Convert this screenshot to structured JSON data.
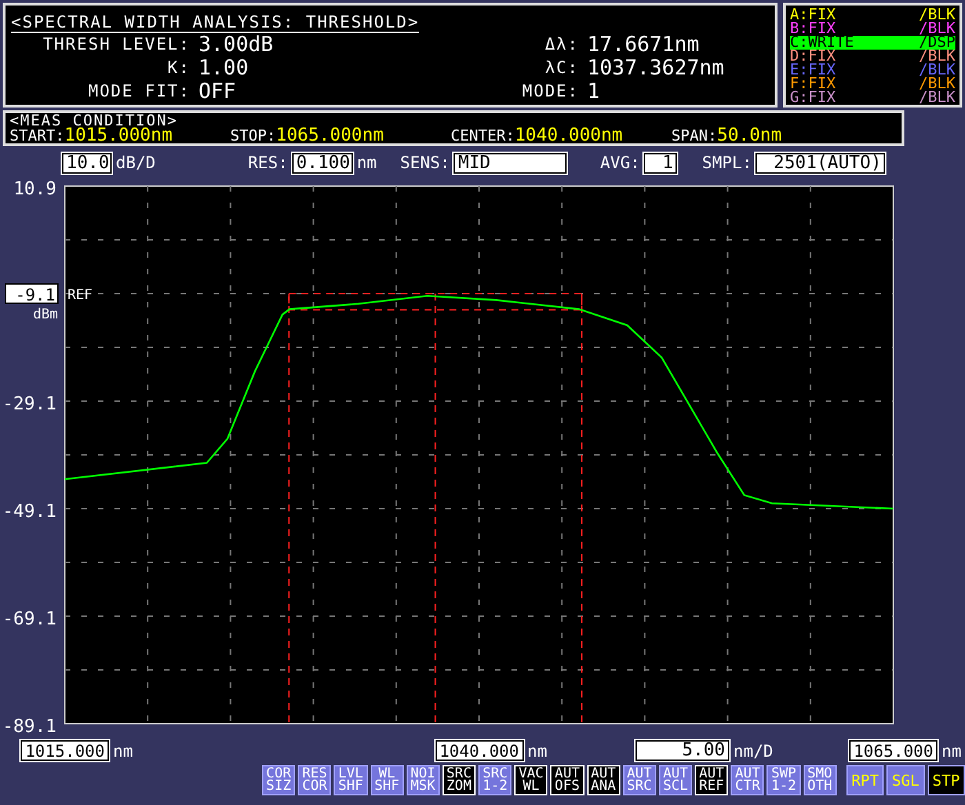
{
  "analysis": {
    "title": "<SPECTRAL WIDTH ANALYSIS: THRESHOLD>",
    "params": [
      {
        "label": "THRESH LEVEL:",
        "value": "3.00dB"
      },
      {
        "label": "K:",
        "value": "1.00"
      },
      {
        "label": "MODE FIT:",
        "value": "OFF"
      }
    ],
    "results": [
      {
        "label": "Δλ:",
        "value": "17.6671nm"
      },
      {
        "label": "λC:",
        "value": "1037.3627nm"
      },
      {
        "label": "MODE:",
        "value": "1"
      }
    ]
  },
  "traces": [
    {
      "name": "A:FIX",
      "display": "/BLK",
      "color": "#ffff00",
      "selected": false
    },
    {
      "name": "B:FIX",
      "display": "/BLK",
      "color": "#ff40ff",
      "selected": false
    },
    {
      "name": "C:WRITE",
      "display": "/DSP",
      "color": "#00ff00",
      "selected": true
    },
    {
      "name": "D:FIX",
      "display": "/BLK",
      "color": "#ff9080",
      "selected": false
    },
    {
      "name": "E:FIX",
      "display": "/BLK",
      "color": "#6868ff",
      "selected": false
    },
    {
      "name": "F:FIX",
      "display": "/BLK",
      "color": "#ff9a00",
      "selected": false
    },
    {
      "name": "G:FIX",
      "display": "/BLK",
      "color": "#c890c8",
      "selected": false
    }
  ],
  "meas_condition": {
    "title": "<MEAS CONDITION>",
    "items": [
      {
        "label": "START:",
        "value": "1015.000nm"
      },
      {
        "label": "STOP:",
        "value": "1065.000nm"
      },
      {
        "label": "CENTER:",
        "value": "1040.000nm"
      },
      {
        "label": "SPAN:",
        "value": "50.0nm"
      }
    ]
  },
  "settings": {
    "scale": {
      "value": "10.0",
      "unit": "dB/D"
    },
    "res": {
      "label": "RES:",
      "value": "0.100",
      "unit": "nm"
    },
    "sens": {
      "label": "SENS:",
      "value": "MID"
    },
    "avg": {
      "label": "AVG:",
      "value": "1"
    },
    "smpl": {
      "label": "SMPL:",
      "value": "2501(AUTO)"
    }
  },
  "ref_level": {
    "value": "-9.1",
    "unit": "dBm",
    "label": "REF"
  },
  "chart_data": {
    "type": "line",
    "xlim": [
      1015,
      1065
    ],
    "ylim": [
      -89.1,
      10.9
    ],
    "yticks": [
      {
        "value": 10.9,
        "label": "10.9"
      },
      {
        "value": -29.1,
        "label": "-29.1"
      },
      {
        "value": -49.1,
        "label": "-49.1"
      },
      {
        "value": -69.1,
        "label": "-69.1"
      },
      {
        "value": -89.1,
        "label": "-89.1"
      }
    ],
    "x": [
      1015,
      1023.57,
      1024.82,
      1026.48,
      1028.14,
      1028.56,
      1032.72,
      1036.88,
      1041.04,
      1046.03,
      1048.94,
      1051.02,
      1054.35,
      1056.01,
      1057.68,
      1065
    ],
    "grid": true,
    "ref_lines": [
      {
        "axis": "x",
        "value": 1028.53
      },
      {
        "axis": "x",
        "value": 1037.36
      },
      {
        "axis": "x",
        "value": 1046.2
      }
    ],
    "xticks": [
      {
        "value": 1015,
        "label": "1015.000"
      },
      {
        "value": 1040,
        "label": "1040.000"
      },
      {
        "value": 1065,
        "label": "1065.000"
      }
    ],
    "series": [
      {
        "color": "#00ff00",
        "values": [
          -43.6,
          -40.6,
          -36.1,
          -23.5,
          -13,
          -12,
          -11,
          -9.5,
          -10.3,
          -12,
          -15,
          -21,
          -38.6,
          -46.6,
          -48.1,
          -49.1
        ]
      }
    ]
  },
  "x_axis": {
    "tick_units": [
      "nm",
      "nm",
      "nm"
    ],
    "span": {
      "value": "5.00",
      "unit": "nm/D"
    }
  },
  "soft_keys": [
    {
      "label": "COR SIZ",
      "on": false
    },
    {
      "label": "RES COR",
      "on": false
    },
    {
      "label": "LVL SHF",
      "on": false
    },
    {
      "label": "WL SHF",
      "on": false
    },
    {
      "label": "NOI MSK",
      "on": false
    },
    {
      "label": "SRC ZOM",
      "on": true
    },
    {
      "label": "SRC 1-2",
      "on": false
    },
    {
      "label": "VAC WL",
      "on": true
    },
    {
      "label": "AUT OFS",
      "on": true
    },
    {
      "label": "AUT ANA",
      "on": true
    },
    {
      "label": "AUT SRC",
      "on": false
    },
    {
      "label": "AUT SCL",
      "on": false
    },
    {
      "label": "AUT REF",
      "on": true
    },
    {
      "label": "AUT CTR",
      "on": false
    },
    {
      "label": "SWP 1-2",
      "on": false
    },
    {
      "label": "SMO OTH",
      "on": false
    }
  ],
  "sweep_keys": [
    {
      "label": "RPT",
      "selected": false
    },
    {
      "label": "SGL",
      "selected": false
    },
    {
      "label": "STP",
      "selected": true
    }
  ]
}
